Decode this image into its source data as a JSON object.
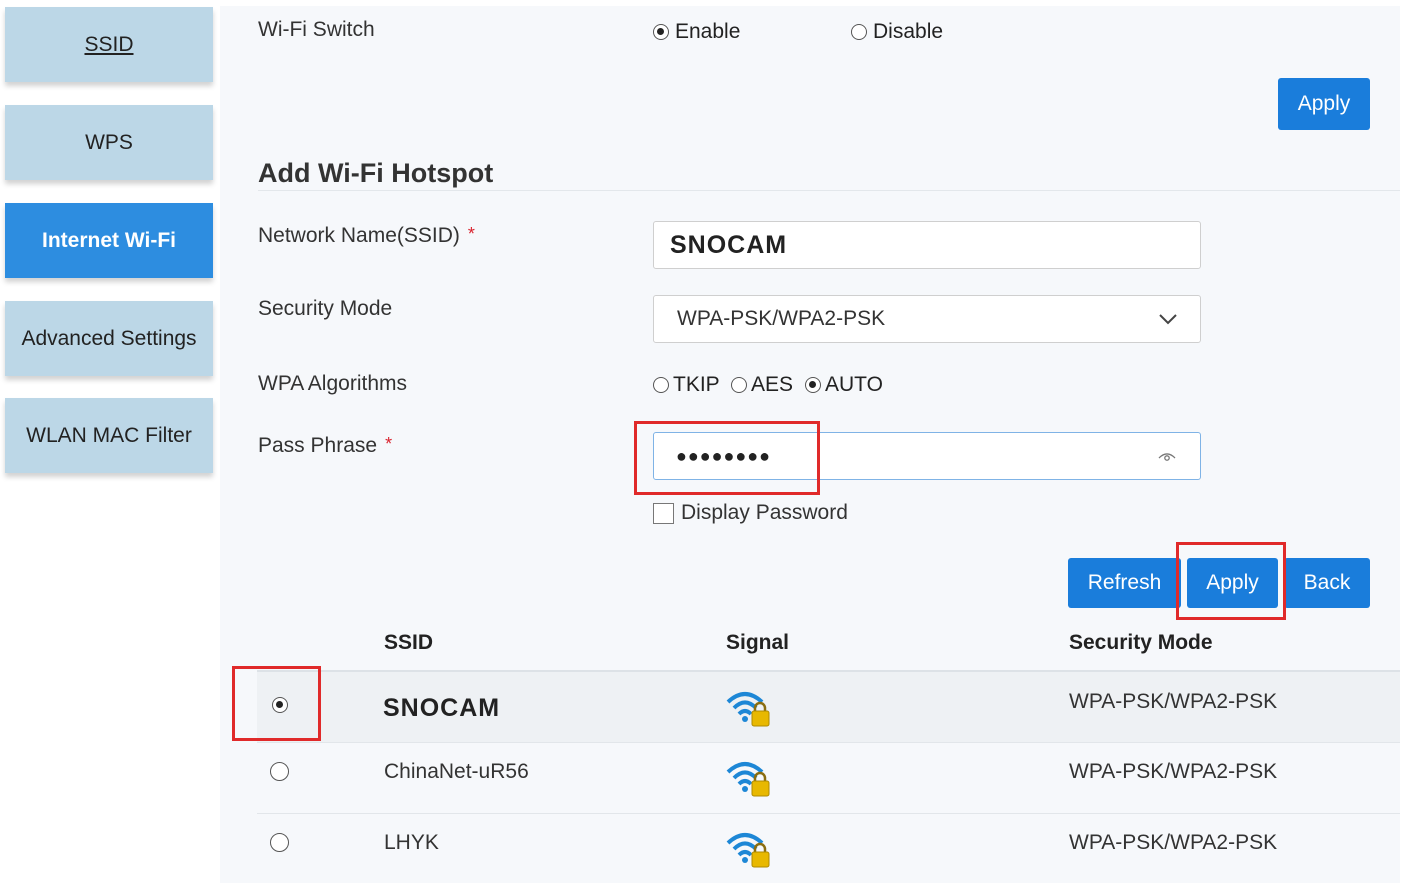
{
  "sidebar": {
    "items": [
      {
        "label": "SSID"
      },
      {
        "label": "WPS"
      },
      {
        "label": "Internet Wi-Fi"
      },
      {
        "label": "Advanced Settings"
      },
      {
        "label": "WLAN MAC Filter"
      }
    ]
  },
  "wifi_switch": {
    "label": "Wi-Fi Switch",
    "enable_label": "Enable",
    "disable_label": "Disable",
    "selected": "Enable",
    "apply_label": "Apply"
  },
  "hotspot": {
    "title": "Add Wi-Fi Hotspot",
    "ssid_label": "Network Name(SSID)",
    "required_mark": "*",
    "ssid_value": "SNOCAM",
    "security_label": "Security Mode",
    "security_value": "WPA-PSK/WPA2-PSK",
    "wpa_label": "WPA Algorithms",
    "wpa_options": [
      "TKIP",
      "AES",
      "AUTO"
    ],
    "wpa_selected": "AUTO",
    "pass_label": "Pass Phrase",
    "pass_value": "●●●●●●●●",
    "display_password_label": "Display Password"
  },
  "actions": {
    "refresh_label": "Refresh",
    "apply_label": "Apply",
    "back_label": "Back"
  },
  "table": {
    "headers": {
      "ssid": "SSID",
      "signal": "Signal",
      "security": "Security Mode"
    },
    "rows": [
      {
        "ssid": "SNOCAM",
        "security": "WPA-PSK/WPA2-PSK",
        "selected": true
      },
      {
        "ssid": "ChinaNet-uR56",
        "security": "WPA-PSK/WPA2-PSK",
        "selected": false
      },
      {
        "ssid": "LHYK",
        "security": "WPA-PSK/WPA2-PSK",
        "selected": false
      }
    ]
  },
  "colors": {
    "accent": "#1a7ddb",
    "sidebar": "#bcd7e7",
    "highlight": "#e02a2a"
  }
}
